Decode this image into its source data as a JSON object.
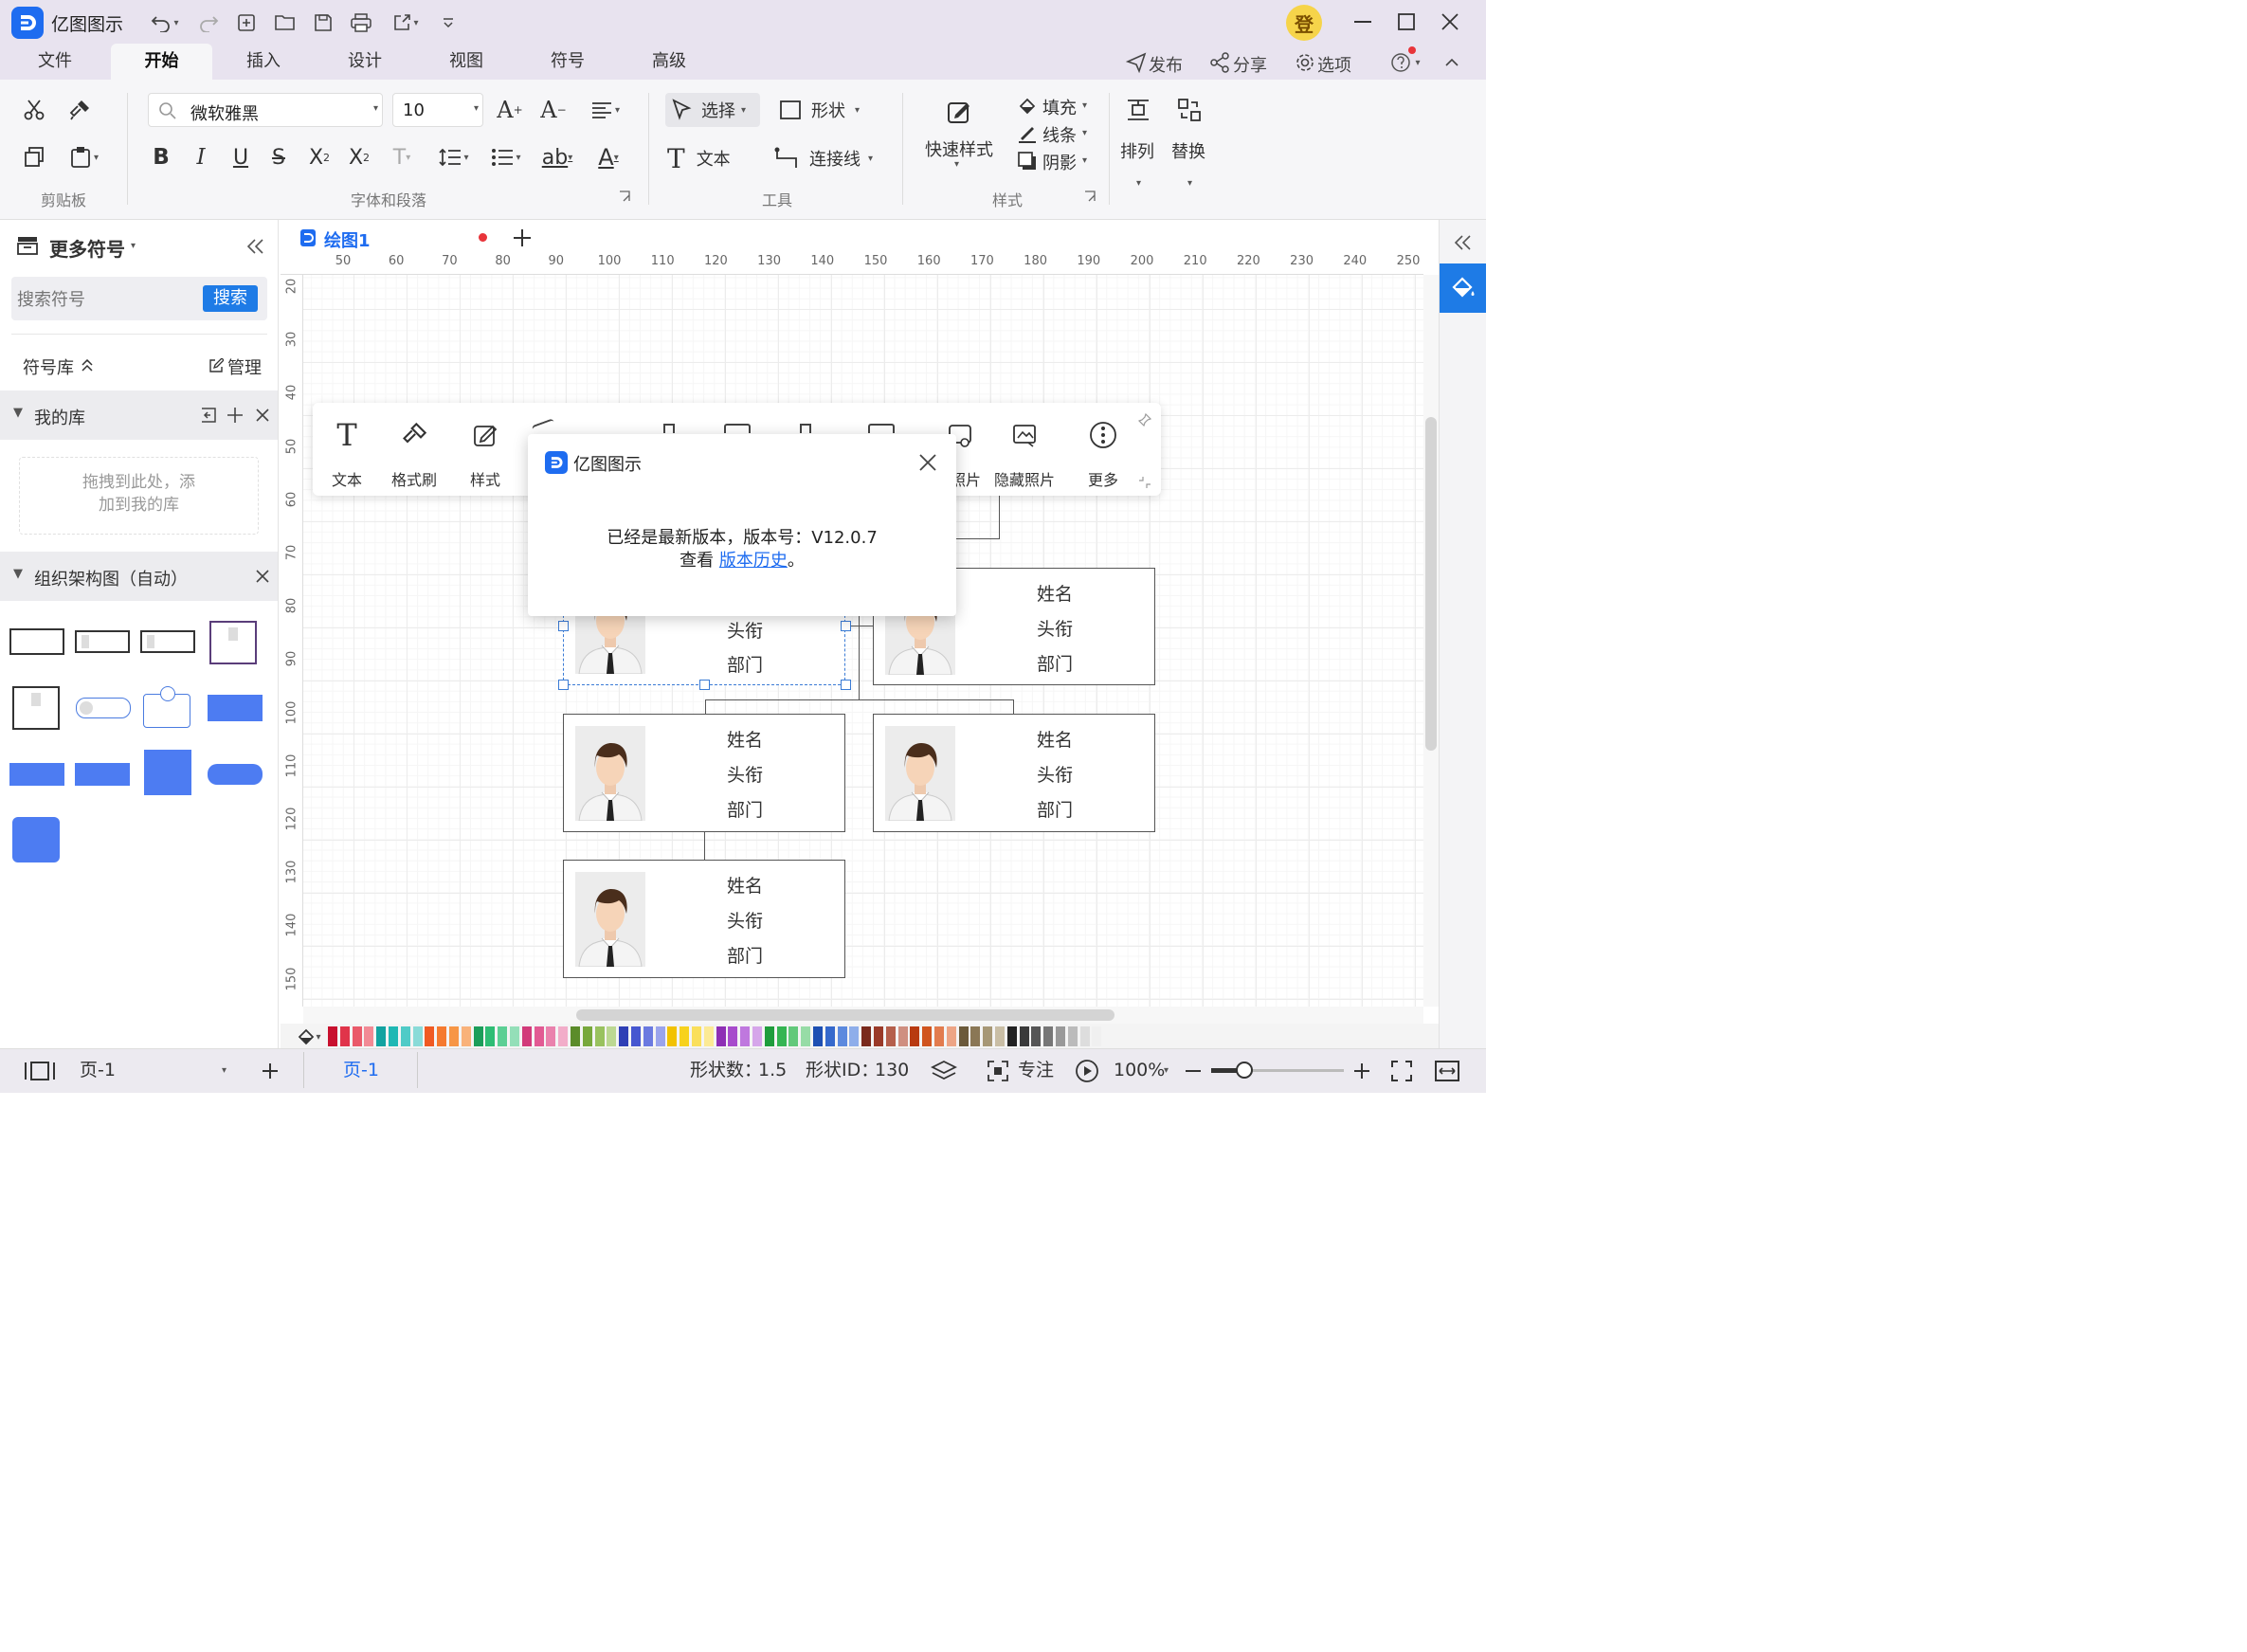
{
  "app": {
    "title": "亿图图示",
    "user_initial": "登"
  },
  "menu_tabs": [
    "文件",
    "开始",
    "插入",
    "设计",
    "视图",
    "符号",
    "高级"
  ],
  "active_tab": "开始",
  "top_actions": {
    "publish": "发布",
    "share": "分享",
    "options": "选项"
  },
  "ribbon": {
    "groups": {
      "clipboard": "剪贴板",
      "font_para": "字体和段落",
      "tools": "工具",
      "style": "样式"
    },
    "font_name": "微软雅黑",
    "font_size": "10",
    "tools": {
      "select": "选择",
      "shape": "形状",
      "text": "文本",
      "connector": "连接线"
    },
    "quick_style": "快速样式",
    "fill": "填充",
    "line": "线条",
    "shadow": "阴影",
    "arrange": "排列",
    "replace": "替换"
  },
  "left_panel": {
    "title": "更多符号",
    "search_placeholder": "搜索符号",
    "search_button": "搜索",
    "library": "符号库",
    "manage": "管理",
    "my_library": "我的库",
    "drop_hint": "拖拽到此处，添加到我的库",
    "org_section": "组织架构图（自动）"
  },
  "doc_tab": {
    "name": "绘图1"
  },
  "ruler": {
    "h": [
      "50",
      "60",
      "70",
      "80",
      "90",
      "100",
      "110",
      "120",
      "130",
      "140",
      "150",
      "160",
      "170",
      "180",
      "190",
      "200",
      "210",
      "220",
      "230",
      "240",
      "250"
    ],
    "v": [
      "20",
      "30",
      "40",
      "50",
      "60",
      "70",
      "80",
      "90",
      "100",
      "110",
      "120",
      "130",
      "140",
      "150"
    ]
  },
  "cards": [
    {
      "name": "姓名",
      "title": "头衔",
      "dept": "部门"
    },
    {
      "name": "姓名",
      "title": "头衔",
      "dept": "部门"
    },
    {
      "name": "姓名",
      "title": "头衔",
      "dept": "部门"
    },
    {
      "name": "姓名",
      "title": "头衔",
      "dept": "部门"
    },
    {
      "name": "姓名",
      "title": "头衔",
      "dept": "部门"
    }
  ],
  "floating_toolbar": {
    "text": "文本",
    "format_painter": "格式刷",
    "style": "样式",
    "photo": "照片",
    "hide_photo": "隐藏照片",
    "more": "更多"
  },
  "dialog": {
    "title": "亿图图示",
    "message": "已经是最新版本，版本号：V12.0.7",
    "view_prefix": "查看",
    "link": "版本历史",
    "suffix": "。"
  },
  "status": {
    "page_selector": "页-1",
    "page_tab": "页-1",
    "shape_count_label": "形状数：",
    "shape_count": "1.5",
    "shape_id_label": "形状ID：",
    "shape_id": "130",
    "focus": "专注",
    "zoom": "100%"
  },
  "palette": [
    "#c8102e",
    "#e0344a",
    "#ea5a6a",
    "#f28a95",
    "#12a3a1",
    "#1fb8b4",
    "#4fcbc7",
    "#8adbd8",
    "#f05a22",
    "#f57a2f",
    "#f79645",
    "#f9b27a",
    "#1b9e5a",
    "#2ebd74",
    "#5ccf94",
    "#94dfb8",
    "#d23b7a",
    "#e25a93",
    "#ea82ad",
    "#f2adc9",
    "#5b8c2a",
    "#78a83c",
    "#99c25f",
    "#bcd892",
    "#2f3fb5",
    "#4657d0",
    "#6b7ae0",
    "#9aa4ec",
    "#f2c200",
    "#f7d21c",
    "#fadf5a",
    "#fcea95",
    "#8e2fb5",
    "#a74ccc",
    "#bf78de",
    "#d6a6ea",
    "#1f9d3c",
    "#35b552",
    "#62c97a",
    "#97dca6",
    "#1e50b3",
    "#3569cc",
    "#5c8ade",
    "#8eaeea",
    "#7a2a1c",
    "#9a3a28",
    "#b5604c",
    "#cf8f80",
    "#b83a10",
    "#d0551f",
    "#e27c4e",
    "#eda585",
    "#6b5a3a",
    "#8a7755",
    "#a79876",
    "#c9bea5",
    "#222222",
    "#3a3a3a",
    "#555555",
    "#777777",
    "#999999",
    "#bbbbbb",
    "#dddddd",
    "#f0f0f0"
  ]
}
